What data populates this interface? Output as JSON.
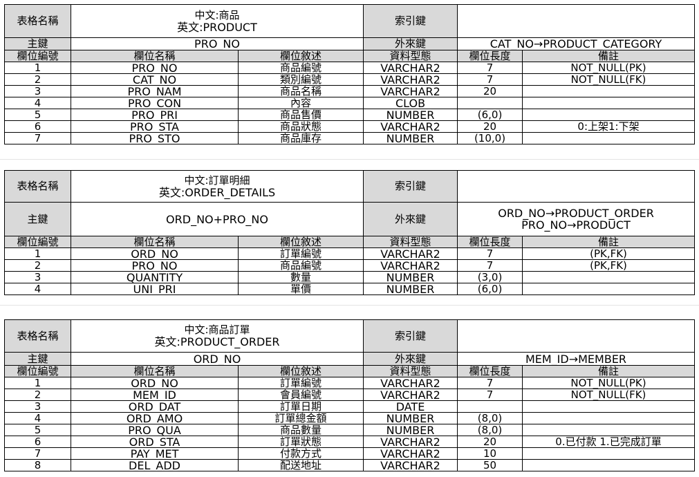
{
  "labels": {
    "table_name": "表格名稱",
    "index_key": "索引鍵",
    "primary_key": "主鍵",
    "foreign_key": "外來鍵",
    "col_no": "欄位編號",
    "col_name": "欄位名稱",
    "col_desc": "欄位敘述",
    "col_type": "資料型態",
    "col_len": "欄位長度",
    "col_note": "備註"
  },
  "tables": [
    {
      "zh": "中文:商品",
      "en": "英文:PRODUCT",
      "index_key": "",
      "primary_key": "PRO_NO",
      "foreign_keys": [
        "CAT_NO→PRODUCT_CATEGORY"
      ],
      "rows": [
        {
          "no": "1",
          "name": "PRO_NO",
          "desc": "商品編號",
          "type": "VARCHAR2",
          "len": "7",
          "note": "NOT_NULL(PK)"
        },
        {
          "no": "2",
          "name": "CAT_NO",
          "desc": "類別編號",
          "type": "VARCHAR2",
          "len": "7",
          "note": "NOT_NULL(FK)"
        },
        {
          "no": "3",
          "name": "PRO_NAM",
          "desc": "商品名稱",
          "type": "VARCHAR2",
          "len": "20",
          "note": ""
        },
        {
          "no": "4",
          "name": "PRO_CON",
          "desc": "內容",
          "type": "CLOB",
          "len": "",
          "note": ""
        },
        {
          "no": "5",
          "name": "PRO_PRI",
          "desc": "商品售價",
          "type": "NUMBER",
          "len": "(6,0)",
          "note": ""
        },
        {
          "no": "6",
          "name": "PRO_STA",
          "desc": "商品狀態",
          "type": "VARCHAR2",
          "len": "20",
          "note": "0:上架1:下架"
        },
        {
          "no": "7",
          "name": "PRO_STO",
          "desc": "商品庫存",
          "type": "NUMBER",
          "len": "(10,0)",
          "note": ""
        }
      ]
    },
    {
      "zh": "中文:訂單明細",
      "en": "英文:ORDER_DETAILS",
      "index_key": "",
      "primary_key": "ORD_NO+PRO_NO",
      "foreign_keys": [
        "ORD_NO→PRODUCT_ORDER",
        "PRO_NO→PRODUCT"
      ],
      "rows": [
        {
          "no": "1",
          "name": "ORD_NO",
          "desc": "訂單編號",
          "type": "VARCHAR2",
          "len": "7",
          "note": "(PK,FK)"
        },
        {
          "no": "2",
          "name": "PRO_NO",
          "desc": "商品編號",
          "type": "VARCHAR2",
          "len": "7",
          "note": "(PK,FK)"
        },
        {
          "no": "3",
          "name": "QUANTITY",
          "desc": "數量",
          "type": "NUMBER",
          "len": "(3,0)",
          "note": ""
        },
        {
          "no": "4",
          "name": "UNI_PRI",
          "desc": "單價",
          "type": "NUMBER",
          "len": "(6,0)",
          "note": ""
        }
      ]
    },
    {
      "zh": "中文:商品訂單",
      "en": "英文:PRODUCT_ORDER",
      "index_key": "",
      "primary_key": "ORD_NO",
      "foreign_keys": [
        "MEM_ID→MEMBER"
      ],
      "rows": [
        {
          "no": "1",
          "name": "ORD_NO",
          "desc": "訂單編號",
          "type": "VARCHAR2",
          "len": "7",
          "note": "NOT_NULL(PK)"
        },
        {
          "no": "2",
          "name": "MEM_ID",
          "desc": "會員編號",
          "type": "VARCHAR2",
          "len": "7",
          "note": "NOT_NULL(FK)"
        },
        {
          "no": "3",
          "name": "ORD_DAT",
          "desc": "訂單日期",
          "type": "DATE",
          "len": "",
          "note": ""
        },
        {
          "no": "4",
          "name": "ORD_AMO",
          "desc": "訂單總金額",
          "type": "NUMBER",
          "len": "(8,0)",
          "note": ""
        },
        {
          "no": "5",
          "name": "PRO_QUA",
          "desc": "商品數量",
          "type": "NUMBER",
          "len": "(8,0)",
          "note": ""
        },
        {
          "no": "6",
          "name": "ORD_STA",
          "desc": "訂單狀態",
          "type": "VARCHAR2",
          "len": "20",
          "note": "0.已付款 1.已完成訂單"
        },
        {
          "no": "7",
          "name": "PAY_MET",
          "desc": "付款方式",
          "type": "VARCHAR2",
          "len": "10",
          "note": ""
        },
        {
          "no": "8",
          "name": "DEL_ADD",
          "desc": "配送地址",
          "type": "VARCHAR2",
          "len": "50",
          "note": ""
        }
      ]
    }
  ]
}
